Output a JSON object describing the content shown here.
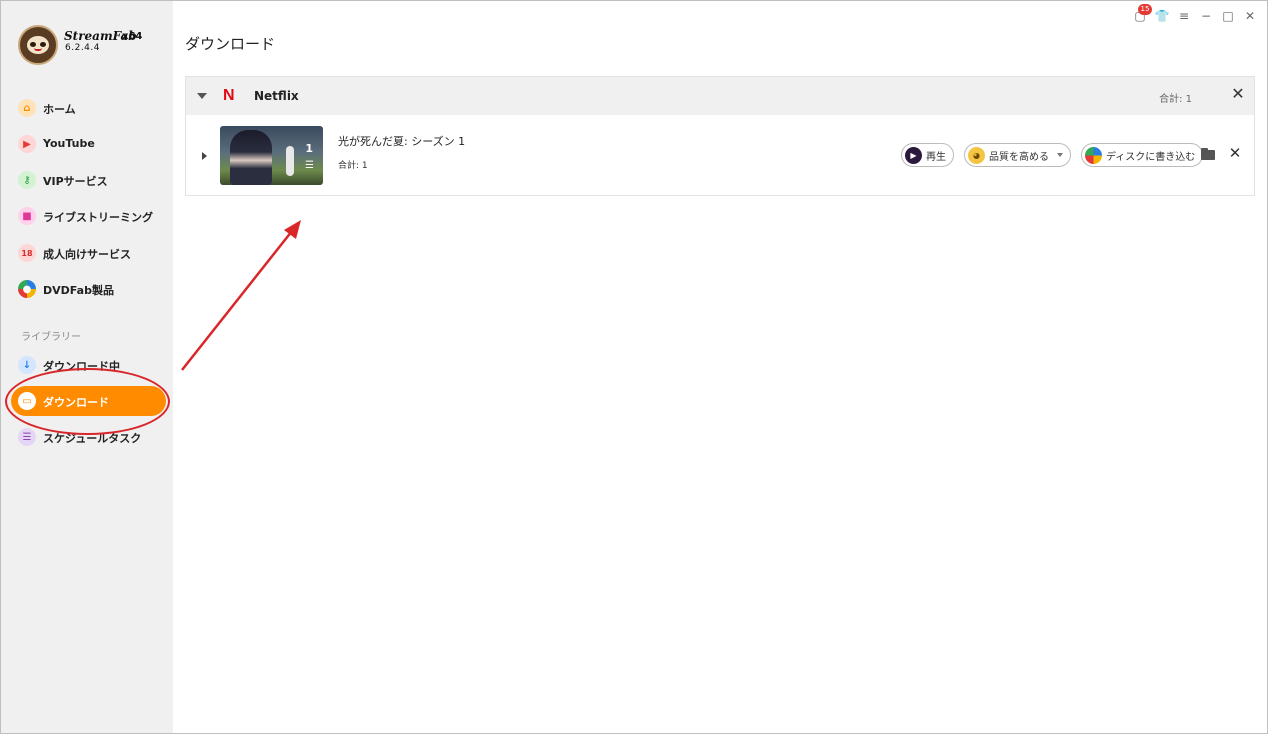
{
  "brand": {
    "name": "StreamFab",
    "arch": "x64",
    "version": "6.2.4.4"
  },
  "sidebar": {
    "items": [
      {
        "label": "ホーム",
        "icon": "home-icon"
      },
      {
        "label": "YouTube",
        "icon": "youtube-icon"
      },
      {
        "label": "VIPサービス",
        "icon": "key-icon"
      },
      {
        "label": "ライブストリーミング",
        "icon": "video-camera-icon"
      },
      {
        "label": "成人向けサービス",
        "icon": "adult-18-icon"
      },
      {
        "label": "DVDFab製品",
        "icon": "dvdfab-icon"
      }
    ],
    "library_label": "ライブラリー",
    "library_items": [
      {
        "label": "ダウンロード中",
        "icon": "download-arrow-icon"
      },
      {
        "label": "ダウンロード",
        "icon": "folder-icon",
        "active": true
      },
      {
        "label": "スケジュールタスク",
        "icon": "schedule-list-icon"
      }
    ]
  },
  "window_controls": {
    "notification_count": "15"
  },
  "page": {
    "title": "ダウンロード"
  },
  "group": {
    "service_logo": "N",
    "service_name": "Netflix",
    "total_label": "合計: 1",
    "items": [
      {
        "title": "光が死んだ夏: シーズン 1",
        "total_label": "合計: 1",
        "episode_count": "1"
      }
    ]
  },
  "actions": {
    "play_label": "再生",
    "enhance_label": "品質を高める",
    "burn_label": "ディスクに書き込む"
  },
  "colors": {
    "accent": "#ff8c00",
    "netflix_red": "#e50914",
    "annotation_red": "#d9262a",
    "sidebar_bg": "#f0f0f0"
  }
}
